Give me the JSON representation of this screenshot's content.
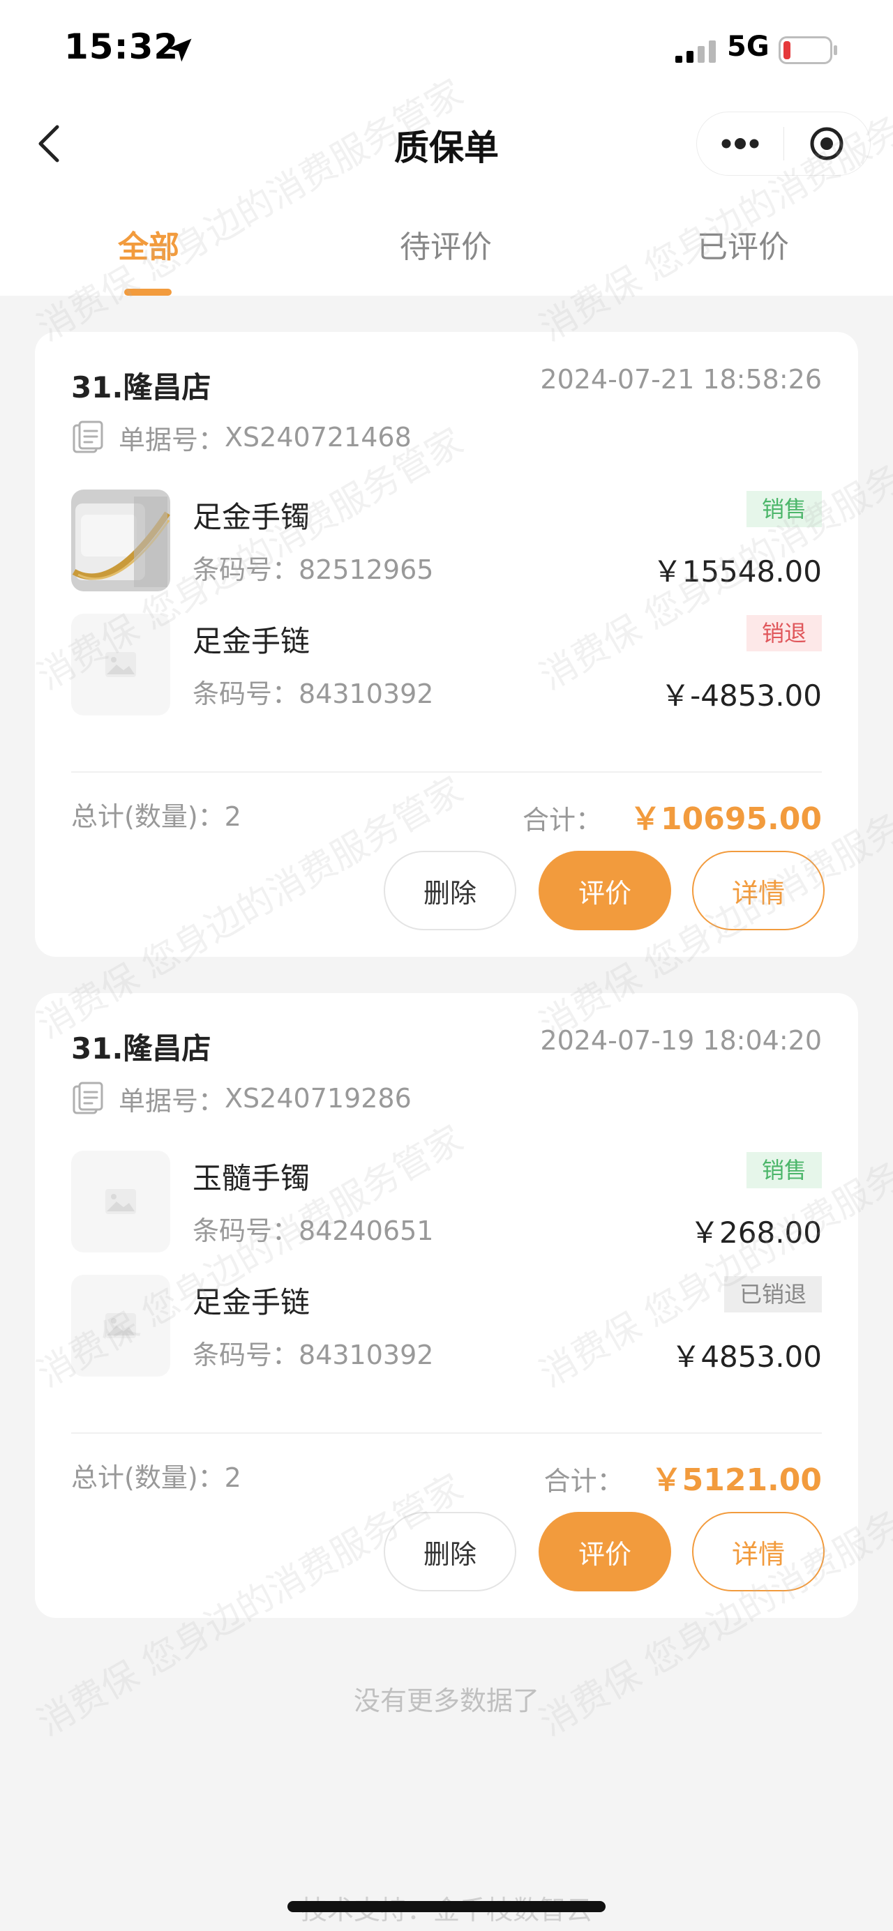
{
  "status_bar": {
    "time": "15:32",
    "network": "5G"
  },
  "nav": {
    "title": "质保单"
  },
  "tabs": [
    {
      "label": "全部",
      "active": true
    },
    {
      "label": "待评价",
      "active": false
    },
    {
      "label": "已评价",
      "active": false
    }
  ],
  "orders": [
    {
      "store": "31.隆昌店",
      "datetime": "2024-07-21 18:58:26",
      "doc_label": "单据号：",
      "doc_no": "XS240721468",
      "items": [
        {
          "name": "足金手镯",
          "barcode_label": "条码号：",
          "barcode": "82512965",
          "tag": "销售",
          "price": "￥15548.00",
          "has_photo": true
        },
        {
          "name": "足金手链",
          "barcode_label": "条码号：",
          "barcode": "84310392",
          "tag": "销退",
          "price": "￥-4853.00",
          "has_photo": false
        }
      ],
      "qty_label": "总计(数量)：",
      "qty": "2",
      "sum_label": "合计：",
      "sum": "￥10695.00",
      "buttons": {
        "delete": "删除",
        "rate": "评价",
        "detail": "详情"
      }
    },
    {
      "store": "31.隆昌店",
      "datetime": "2024-07-19 18:04:20",
      "doc_label": "单据号：",
      "doc_no": "XS240719286",
      "items": [
        {
          "name": "玉髓手镯",
          "barcode_label": "条码号：",
          "barcode": "84240651",
          "tag": "销售",
          "price": "￥268.00",
          "has_photo": false
        },
        {
          "name": "足金手链",
          "barcode_label": "条码号：",
          "barcode": "84310392",
          "tag": "已销退",
          "price": "￥4853.00",
          "has_photo": false
        }
      ],
      "qty_label": "总计(数量)：",
      "qty": "2",
      "sum_label": "合计：",
      "sum": "￥5121.00",
      "buttons": {
        "delete": "删除",
        "rate": "评价",
        "detail": "详情"
      }
    }
  ],
  "no_more": "没有更多数据了",
  "footer": "技术支持：金千枝数智云",
  "watermark": "消费保 您身边的消费服务管家",
  "colors": {
    "accent": "#f29b3d",
    "sale": "#4cb66a",
    "refund": "#e0575b",
    "refunded": "#888888"
  }
}
